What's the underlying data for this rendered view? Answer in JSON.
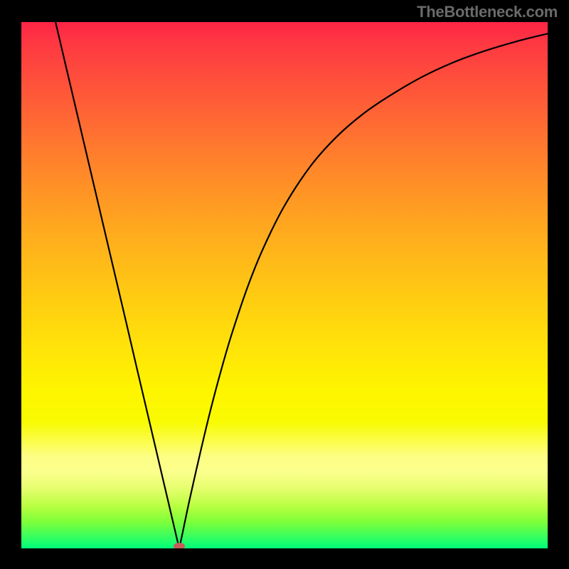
{
  "watermark": "TheBottleneck.com",
  "chart_data": {
    "type": "line",
    "title": "",
    "xlabel": "",
    "ylabel": "",
    "xlim": [
      0,
      100
    ],
    "ylim": [
      0,
      100
    ],
    "background": "rainbow_gradient",
    "gradient_stops": [
      {
        "pos": 0,
        "color": "#fe2445"
      },
      {
        "pos": 14,
        "color": "#ff5938"
      },
      {
        "pos": 33,
        "color": "#ff9624"
      },
      {
        "pos": 54,
        "color": "#ffd010"
      },
      {
        "pos": 70,
        "color": "#fef500"
      },
      {
        "pos": 85,
        "color": "#fbff8c"
      },
      {
        "pos": 100,
        "color": "#00fe7b"
      }
    ],
    "series": [
      {
        "name": "bottleneck-curve",
        "color": "#000000",
        "type": "v-curve",
        "min_point": {
          "x": 30,
          "y": 0
        },
        "x": [
          6.5,
          8,
          10,
          12,
          14,
          16,
          18,
          20,
          22,
          24,
          26,
          28,
          29.5,
          30,
          30.5,
          32,
          34,
          36,
          38,
          40,
          43,
          46,
          50,
          55,
          60,
          65,
          70,
          76,
          82,
          88,
          94,
          100
        ],
        "values": [
          100,
          93.6,
          85.1,
          76.6,
          68.1,
          59.6,
          51.1,
          42.6,
          34,
          25.5,
          17,
          8.5,
          2.1,
          0,
          2.3,
          9.4,
          18.2,
          26.5,
          34,
          40.8,
          49.7,
          57.1,
          65.1,
          72.7,
          78.3,
          82.6,
          86,
          89.5,
          92.3,
          94.5,
          96.3,
          97.8
        ]
      }
    ],
    "marker": {
      "x": 30,
      "y": 0,
      "color": "#c85a5a",
      "shape": "oval"
    }
  }
}
